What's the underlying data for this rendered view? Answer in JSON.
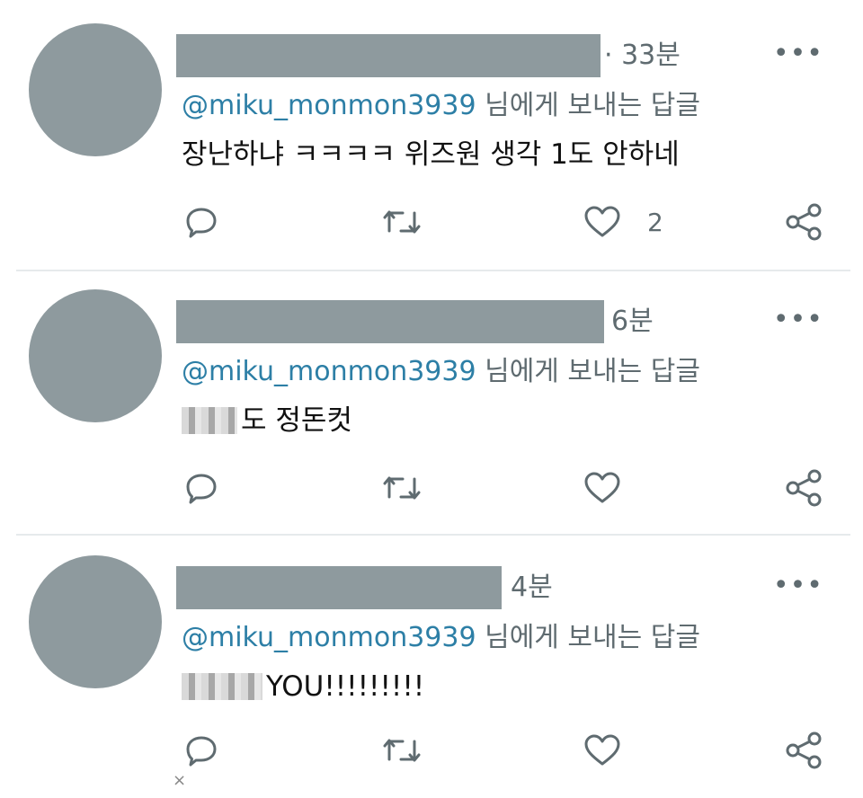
{
  "colors": {
    "redaction": "#8e9a9e",
    "handle": "#2d7fa6",
    "muted": "#5f6b70",
    "divider": "#e6eaec"
  },
  "tweets": [
    {
      "time": "· 33분",
      "more": "•••",
      "reply_handle": "@miku_monmon3939",
      "reply_suffix": " 님에게 보내는 답글",
      "text": "장난하냐 ㅋㅋㅋㅋ 위즈원 생각 1도 안하네",
      "like_count": "2"
    },
    {
      "time": "6분",
      "more": "•••",
      "reply_handle": "@miku_monmon3939",
      "reply_suffix": " 님에게 보내는 답글",
      "text": "도 정돈컷",
      "like_count": ""
    },
    {
      "time": "4분",
      "more": "•••",
      "reply_handle": "@miku_monmon3939",
      "reply_suffix": " 님에게 보내는 답글",
      "text": "YOU!!!!!!!!!",
      "like_count": ""
    }
  ],
  "icons": [
    "reply-icon",
    "retweet-icon",
    "like-icon",
    "share-icon",
    "more-icon",
    "close-icon"
  ],
  "corner_mark": "×"
}
